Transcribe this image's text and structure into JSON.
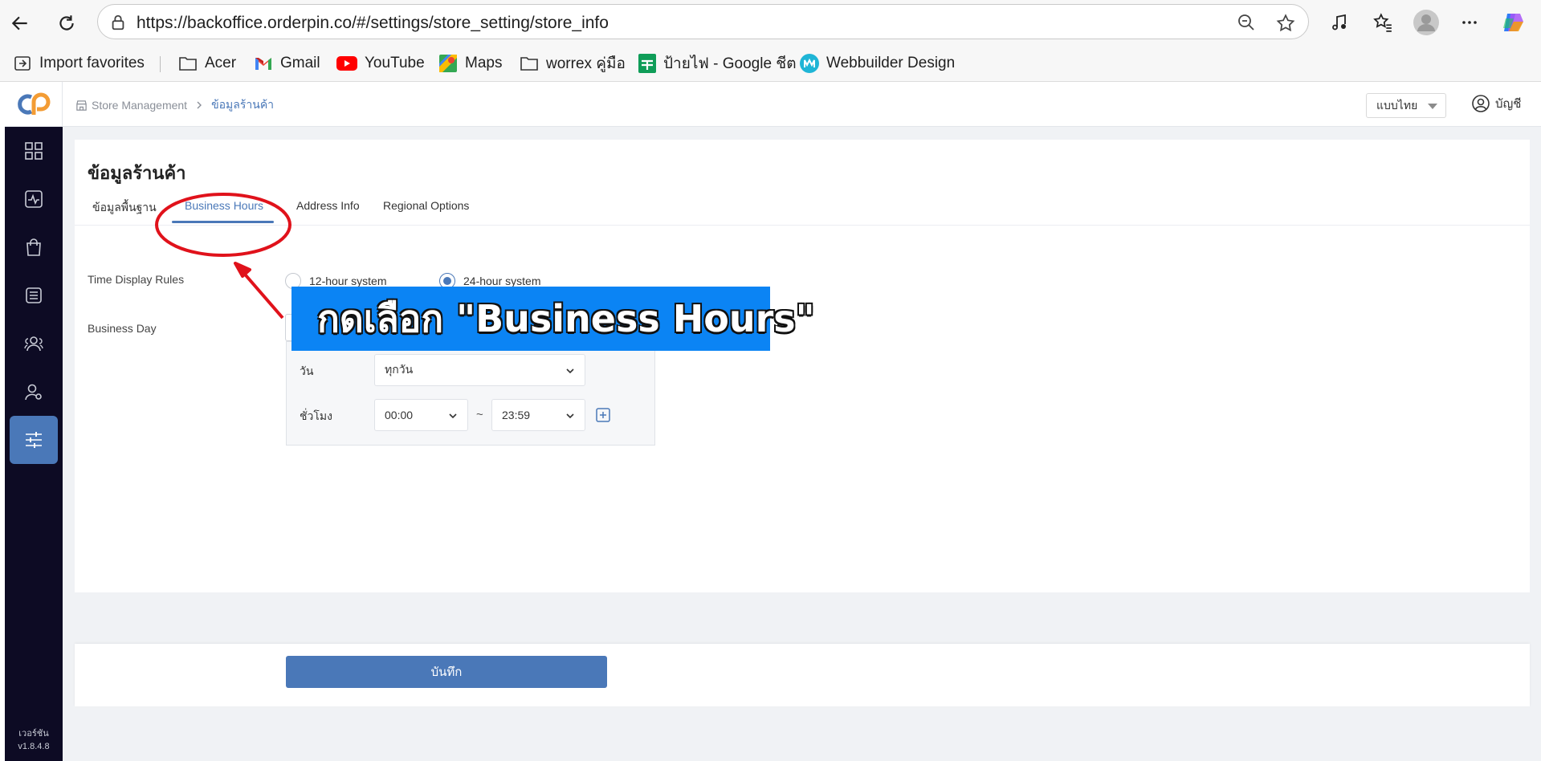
{
  "browser": {
    "url": "https://backoffice.orderpin.co/#/settings/store_setting/store_info",
    "bookmarks": [
      {
        "label": "Import favorites",
        "icon": "import-icon"
      },
      {
        "label": "Acer",
        "icon": "folder-icon"
      },
      {
        "label": "Gmail",
        "icon": "gmail-icon"
      },
      {
        "label": "YouTube",
        "icon": "youtube-icon"
      },
      {
        "label": "Maps",
        "icon": "maps-icon"
      },
      {
        "label": "worrex คู่มือ",
        "icon": "folder-icon"
      },
      {
        "label": "ป้ายไฟ - Google ชีต",
        "icon": "sheets-icon"
      },
      {
        "label": "Webbuilder Design",
        "icon": "webbuilder-icon"
      }
    ]
  },
  "topbar": {
    "breadcrumb_root": "Store Management",
    "breadcrumb_current": "ข้อมูลร้านค้า",
    "language": "แบบไทย",
    "account": "บัญชี"
  },
  "sidebar": {
    "items": [
      {
        "icon": "dashboard-grid-icon",
        "active": false
      },
      {
        "icon": "activity-chart-icon",
        "active": false
      },
      {
        "icon": "shopping-bag-icon",
        "active": false
      },
      {
        "icon": "store-building-icon",
        "active": false
      },
      {
        "icon": "users-group-icon",
        "active": false
      },
      {
        "icon": "user-settings-icon",
        "active": false
      },
      {
        "icon": "sliders-settings-icon",
        "active": true
      }
    ],
    "version_label": "เวอร์ชัน",
    "version": "v1.8.4.8"
  },
  "page": {
    "title": "ข้อมูลร้านค้า",
    "tabs": [
      "ข้อมูลพื้นฐาน",
      "Business Hours",
      "Address Info",
      "Regional Options"
    ],
    "active_tab": "Business Hours",
    "time_display_label": "Time Display Rules",
    "radio_12": "12-hour system",
    "radio_24": "24-hour system",
    "selected_time_system": "24-hour system",
    "business_day_label": "Business Day",
    "day_label": "วัน",
    "day_value": "ทุกวัน",
    "hours_label": "ชั่วโมง",
    "start_time": "00:00",
    "separator": "~",
    "end_time": "23:59",
    "save_label": "บันทึก"
  },
  "annotation": {
    "text": "กดเลือก \"Business Hours\"",
    "banner_color": "#0b84f4",
    "marker_color": "#e0121b"
  },
  "colors": {
    "accent": "#4a78b8",
    "sidebar_bg": "#0d0b24"
  }
}
